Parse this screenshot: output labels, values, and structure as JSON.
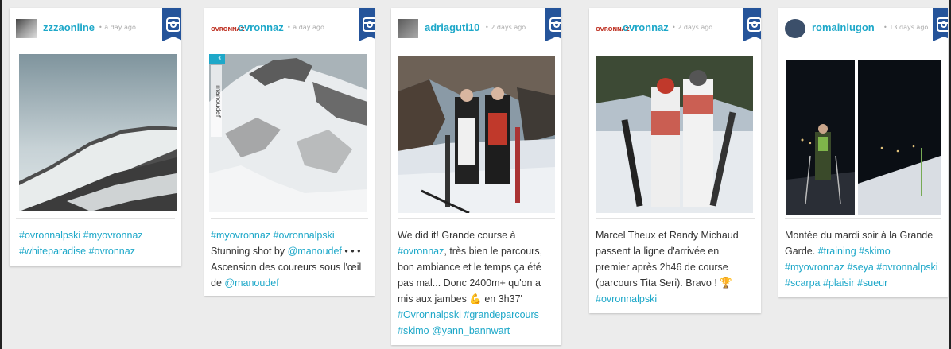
{
  "colors": {
    "accent": "#1ea8c9",
    "badge": "#25549a",
    "text": "#333333"
  },
  "posts": [
    {
      "username": "zzzaonline",
      "time": "• a day ago",
      "source_icon": "instagram-icon",
      "caption_tags": [
        "#ovronnalpski",
        "#myovronnaz",
        "#whiteparadise",
        "#ovronnaz"
      ]
    },
    {
      "username": "ovronnaz",
      "avatar_text": "OVRONNAZ",
      "time": "• a day ago",
      "source_icon": "instagram-icon",
      "photo_badge": "13",
      "photo_credit": "manoudef",
      "caption_tags": [
        "#myovronnaz",
        "#ovronnalpski"
      ],
      "caption_text_1": "Stunning shot by",
      "caption_mention_1": "@manoudef",
      "caption_text_2": "• • • Ascension des coureurs sous l'œil de",
      "caption_mention_2": "@manoudef"
    },
    {
      "username": "adriaguti10",
      "time": "• 2 days ago",
      "source_icon": "instagram-icon",
      "caption_text_1": "We did it! Grande course à",
      "caption_tag_1": "#ovronnaz",
      "caption_text_2": ", très bien le parcours, bon ambiance et le temps ça été pas mal... Donc 2400m+ qu'on a mis aux jambes 💪 en 3h37'",
      "caption_tags": [
        "#Ovronnalpski",
        "#grandeparcours",
        "#skimo"
      ],
      "caption_mention": "@yann_bannwart"
    },
    {
      "username": "ovronnaz",
      "avatar_text": "OVRONNAZ",
      "time": "• 2 days ago",
      "source_icon": "instagram-icon",
      "caption_text": "Marcel Theux et Randy Michaud passent la ligne d'arrivée en premier après 2h46 de course (parcours Tita Seri). Bravo ! 🏆",
      "caption_tag": "#ovronnalpski"
    },
    {
      "username": "romainlugon",
      "time": "• 13 days ago",
      "source_icon": "instagram-icon",
      "caption_text": "Montée du mardi soir à la Grande Garde.",
      "caption_tags": [
        "#training",
        "#skimo",
        "#myovronnaz",
        "#seya",
        "#ovronnalpski",
        "#scarpa",
        "#plaisir",
        "#sueur"
      ]
    }
  ]
}
